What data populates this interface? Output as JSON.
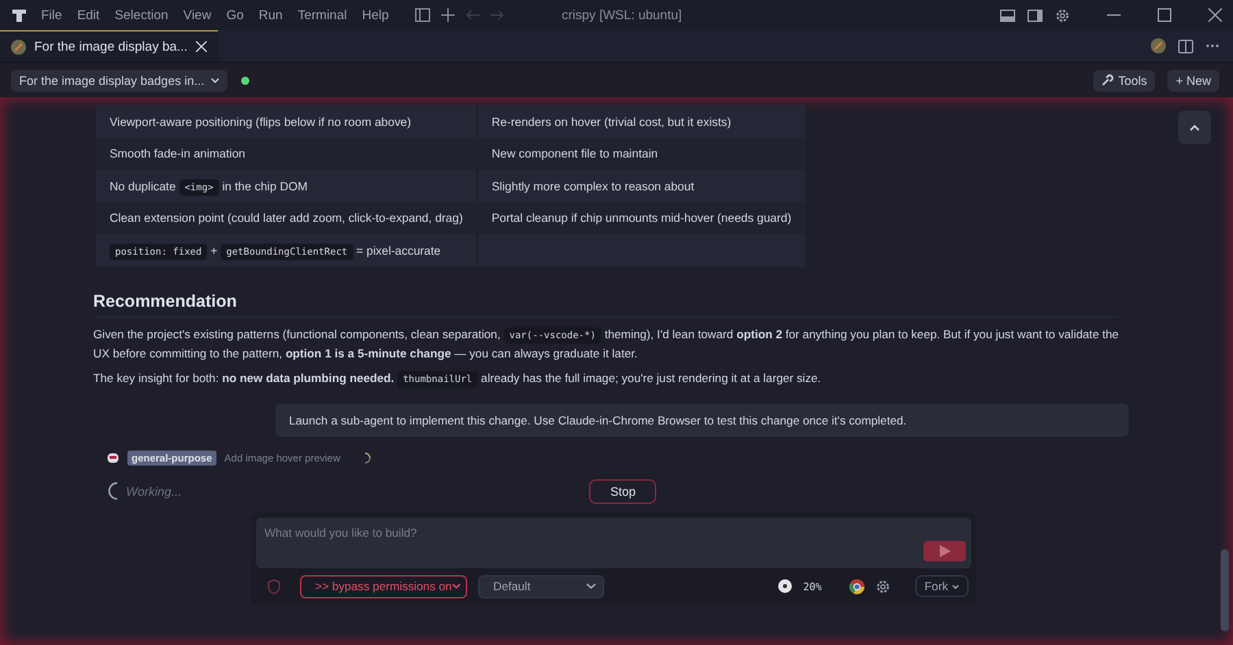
{
  "menu": [
    "File",
    "Edit",
    "Selection",
    "View",
    "Go",
    "Run",
    "Terminal",
    "Help"
  ],
  "window": {
    "title": "crispy [WSL: ubuntu]"
  },
  "tabs": [
    {
      "label": "For the image display ba...",
      "selected": true
    }
  ],
  "session": {
    "label": "For the image display badges in...",
    "online": true
  },
  "toolbar": {
    "tools": "Tools",
    "new": "+ New"
  },
  "table": {
    "rows": [
      [
        [
          {
            "kind": "text",
            "text": "Viewport-aware positioning (flips below if no room above)"
          }
        ],
        [
          {
            "kind": "text",
            "text": "Re-renders on hover (trivial cost, but it exists)"
          }
        ]
      ],
      [
        [
          {
            "kind": "text",
            "text": "Smooth fade-in animation"
          }
        ],
        [
          {
            "kind": "text",
            "text": "New component file to maintain"
          }
        ]
      ],
      [
        [
          {
            "kind": "text",
            "text": "No duplicate "
          },
          {
            "kind": "code",
            "text": "<img>"
          },
          {
            "kind": "text",
            "text": " in the chip DOM"
          }
        ],
        [
          {
            "kind": "text",
            "text": "Slightly more complex to reason about"
          }
        ]
      ],
      [
        [
          {
            "kind": "text",
            "text": "Clean extension point (could later add zoom, click-to-expand, drag)"
          }
        ],
        [
          {
            "kind": "text",
            "text": "Portal cleanup if chip unmounts mid-hover (needs guard)"
          }
        ]
      ],
      [
        [
          {
            "kind": "code",
            "text": "position: fixed"
          },
          {
            "kind": "text",
            "text": " + "
          },
          {
            "kind": "code",
            "text": "getBoundingClientRect"
          },
          {
            "kind": "text",
            "text": " = pixel-accurate"
          }
        ],
        []
      ]
    ]
  },
  "heading": "Recommendation",
  "paragraphs": [
    [
      {
        "kind": "text",
        "text": "Given the project's existing patterns (functional components, clean separation, "
      },
      {
        "kind": "code",
        "text": "var(--vscode-*)"
      },
      {
        "kind": "text",
        "text": " theming), I'd lean toward **option 2** for anything you plan to keep. But if you just want to validate the UX before committing to the pattern, **option 1 is a 5-minute change** — you can always graduate it later."
      }
    ],
    [
      {
        "kind": "text",
        "text": "The key insight for both: **no new data plumbing needed.** "
      },
      {
        "kind": "code",
        "text": "thumbnailUrl"
      },
      {
        "kind": "text",
        "text": " already has the full image; you're just rendering it at a larger size."
      }
    ]
  ],
  "user_message": "Launch a sub-agent to implement this change. Use Claude-in-Chrome Browser to test this change once it's completed.",
  "agent": {
    "type": "general-purpose",
    "task": "Add image hover preview",
    "running": true
  },
  "status": "Working...",
  "stop": "Stop",
  "composer": {
    "placeholder": "What would you like to build?",
    "mode": ">> bypass permissions on",
    "model": "Default",
    "usage": "20%",
    "fork": "Fork"
  }
}
